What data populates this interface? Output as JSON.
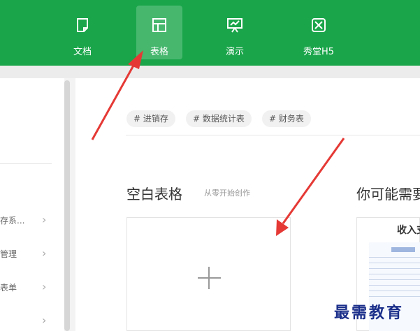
{
  "toolbar": {
    "tabs": [
      {
        "label": "文档",
        "icon": "document-icon"
      },
      {
        "label": "表格",
        "icon": "table-icon"
      },
      {
        "label": "演示",
        "icon": "presentation-icon"
      },
      {
        "label": "秀堂H5",
        "icon": "h5-icon"
      }
    ],
    "active_tab": "表格",
    "accent_color": "#1aa54a"
  },
  "sidebar": {
    "items": [
      {
        "label": "存系...",
        "icon": "chevron-right-icon"
      },
      {
        "label": "管理",
        "icon": "chevron-right-icon"
      },
      {
        "label": "表单",
        "icon": "chevron-right-icon"
      },
      {
        "label": "",
        "icon": "chevron-right-icon"
      }
    ]
  },
  "tags": [
    "# 进销存",
    "# 数据统计表",
    "# 财务表"
  ],
  "blank_section": {
    "title": "空白表格",
    "subtitle": "从零开始创作",
    "plus_icon": "plus-icon"
  },
  "suggest_section": {
    "title": "你可能需要",
    "template_title": "收入支"
  },
  "watermark": "最需教育",
  "annotation_color": "#e53935"
}
